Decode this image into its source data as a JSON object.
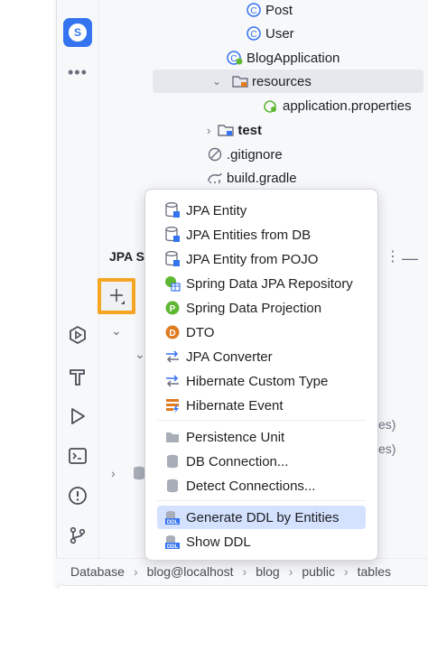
{
  "toolstrip": {
    "project_initial": "S",
    "more": "•••"
  },
  "project_tree": {
    "post": "Post",
    "user": "User",
    "blog_app": "BlogApplication",
    "resources": "resources",
    "app_props": "application.properties",
    "test": "test",
    "gitignore": ".gitignore",
    "build_gradle": "build.gradle"
  },
  "jpa_panel": {
    "header": "JPA S",
    "bg_text_1": "es)",
    "bg_text_2": "es)"
  },
  "menu": {
    "items": [
      {
        "label": "JPA Entity",
        "icon": "jpa-entity-icon"
      },
      {
        "label": "JPA Entities from DB",
        "icon": "jpa-entities-db-icon"
      },
      {
        "label": "JPA Entity from POJO",
        "icon": "jpa-entity-pojo-icon"
      },
      {
        "label": "Spring Data JPA Repository",
        "icon": "spring-repository-icon"
      },
      {
        "label": "Spring Data Projection",
        "icon": "spring-projection-icon"
      },
      {
        "label": "DTO",
        "icon": "dto-icon"
      },
      {
        "label": "JPA Converter",
        "icon": "converter-icon"
      },
      {
        "label": "Hibernate Custom Type",
        "icon": "custom-type-icon"
      },
      {
        "label": "Hibernate Event",
        "icon": "event-icon"
      },
      {
        "label": "Persistence Unit",
        "icon": "persistence-unit-icon"
      },
      {
        "label": "DB Connection...",
        "icon": "db-connection-icon"
      },
      {
        "label": "Detect Connections...",
        "icon": "detect-connections-icon"
      },
      {
        "label": "Generate DDL by Entities",
        "icon": "ddl-icon"
      },
      {
        "label": "Show DDL",
        "icon": "ddl-icon"
      }
    ]
  },
  "breadcrumb": [
    "Database",
    "blog@localhost",
    "blog",
    "public",
    "tables"
  ],
  "colors": {
    "accent": "#3574f0",
    "highlight": "#d4e2ff",
    "focus_border": "#f5a623",
    "spring_green": "#5fb832",
    "dto_orange": "#e07b1f"
  }
}
